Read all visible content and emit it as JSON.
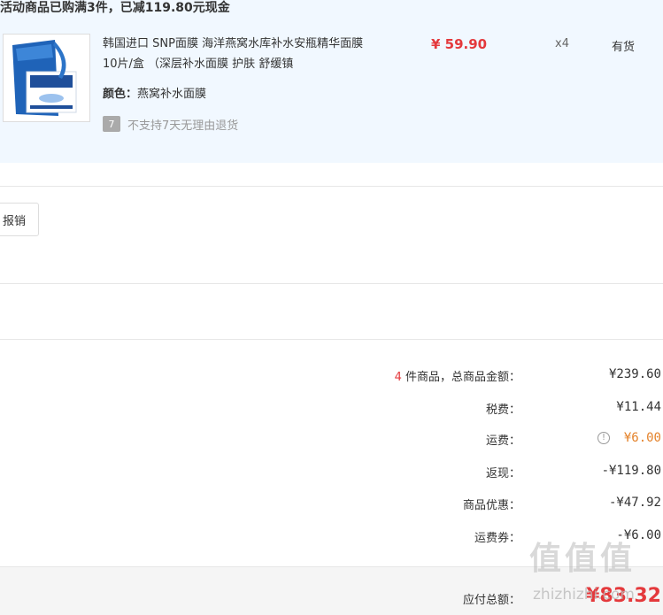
{
  "promo": {
    "title": "活动商品已购满3件，已减119.80元现金"
  },
  "product": {
    "name": "韩国进口 SNP面膜 海洋燕窝水库补水安瓶精华面膜10片/盒 （深层补水面膜 护肤 舒缓镇",
    "attr_key": "颜色：",
    "attr_value": "燕窝补水面膜",
    "return_badge": "7",
    "return_text": "不支持7天无理由退货",
    "price": "¥ 59.90",
    "qty": "x4",
    "stock": "有货"
  },
  "actions": {
    "reimburse_label": "报销"
  },
  "summary": {
    "items_count": "4",
    "items_label_rest": " 件商品，总商品金额：",
    "items_value": "¥239.60",
    "tax_label": "税费：",
    "tax_value": "¥11.44",
    "freight_label": "运费：",
    "freight_value": "¥6.00",
    "cashback_label": "返现：",
    "cashback_value": "-¥119.80",
    "discount_label": "商品优惠：",
    "discount_value": "-¥47.92",
    "coupon_label": "运费券：",
    "coupon_value": "-¥6.00"
  },
  "total": {
    "label": "应付总额：",
    "value": "¥83.32"
  },
  "watermark": {
    "logo_chars": [
      "值",
      "值",
      "值"
    ],
    "url": "zhizhizhi.com"
  },
  "colors": {
    "price_red": "#e4393c",
    "freight_orange": "#e4822a",
    "promo_bg": "#f1f8ff"
  }
}
